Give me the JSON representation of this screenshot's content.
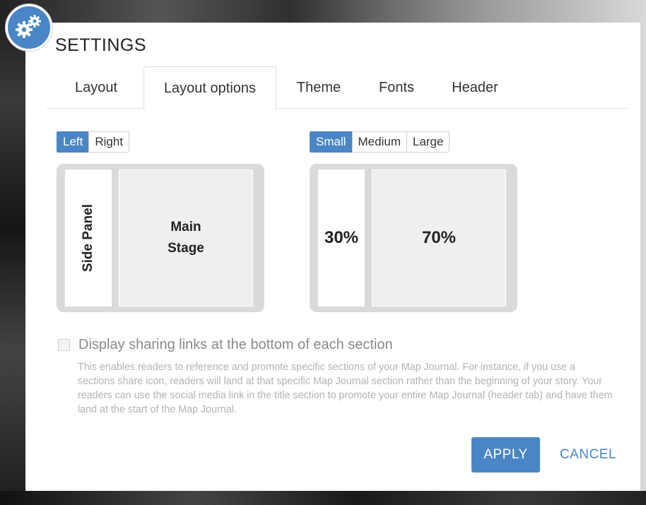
{
  "dialog": {
    "title": "SETTINGS",
    "icon": "gears-icon",
    "accent_color": "#4a86c5"
  },
  "tabs": [
    {
      "label": "Layout",
      "active": false
    },
    {
      "label": "Layout options",
      "active": true
    },
    {
      "label": "Theme",
      "active": false
    },
    {
      "label": "Fonts",
      "active": false
    },
    {
      "label": "Header",
      "active": false
    }
  ],
  "panel_position": {
    "options": [
      "Left",
      "Right"
    ],
    "selected": "Left"
  },
  "panel_size": {
    "options": [
      "Small",
      "Medium",
      "Large"
    ],
    "selected": "Small"
  },
  "layout_preview": {
    "side_label": "Side Panel",
    "main_label_line1": "Main",
    "main_label_line2": "Stage"
  },
  "size_preview": {
    "side_percent": "30%",
    "main_percent": "70%"
  },
  "sharing": {
    "checked": false,
    "label": "Display sharing links at the bottom of each section",
    "description": "This enables readers to reference and promote specific sections of your Map Journal. For instance, if you use a sections share icon, readers will land at that specific Map Journal section rather than the beginning of your story. Your readers can use the social media link in the title section to promote your entire Map Journal (header tab) and have them land at the start of the Map Journal."
  },
  "buttons": {
    "apply": "APPLY",
    "cancel": "CANCEL"
  }
}
